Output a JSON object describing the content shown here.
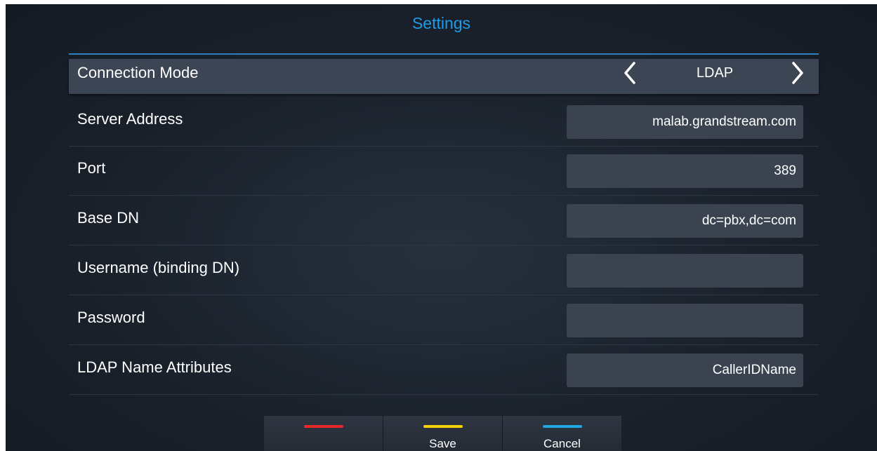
{
  "header": {
    "title": "Settings",
    "accent_color": "#1e9be8"
  },
  "connection_mode": {
    "label": "Connection Mode",
    "value": "LDAP",
    "prev_icon": "chevron-left-icon",
    "next_icon": "chevron-right-icon"
  },
  "fields": [
    {
      "label": "Server Address",
      "value": "malab.grandstream.com"
    },
    {
      "label": "Port",
      "value": "389"
    },
    {
      "label": "Base DN",
      "value": "dc=pbx,dc=com"
    },
    {
      "label": "Username (binding DN)",
      "value": ""
    },
    {
      "label": "Password",
      "value": ""
    },
    {
      "label": "LDAP Name Attributes",
      "value": "CallerIDName"
    }
  ],
  "softkeys": [
    {
      "label": "",
      "color": "#e8262b"
    },
    {
      "label": "Save",
      "color": "#f5d300"
    },
    {
      "label": "Cancel",
      "color": "#1ea7e0"
    }
  ]
}
